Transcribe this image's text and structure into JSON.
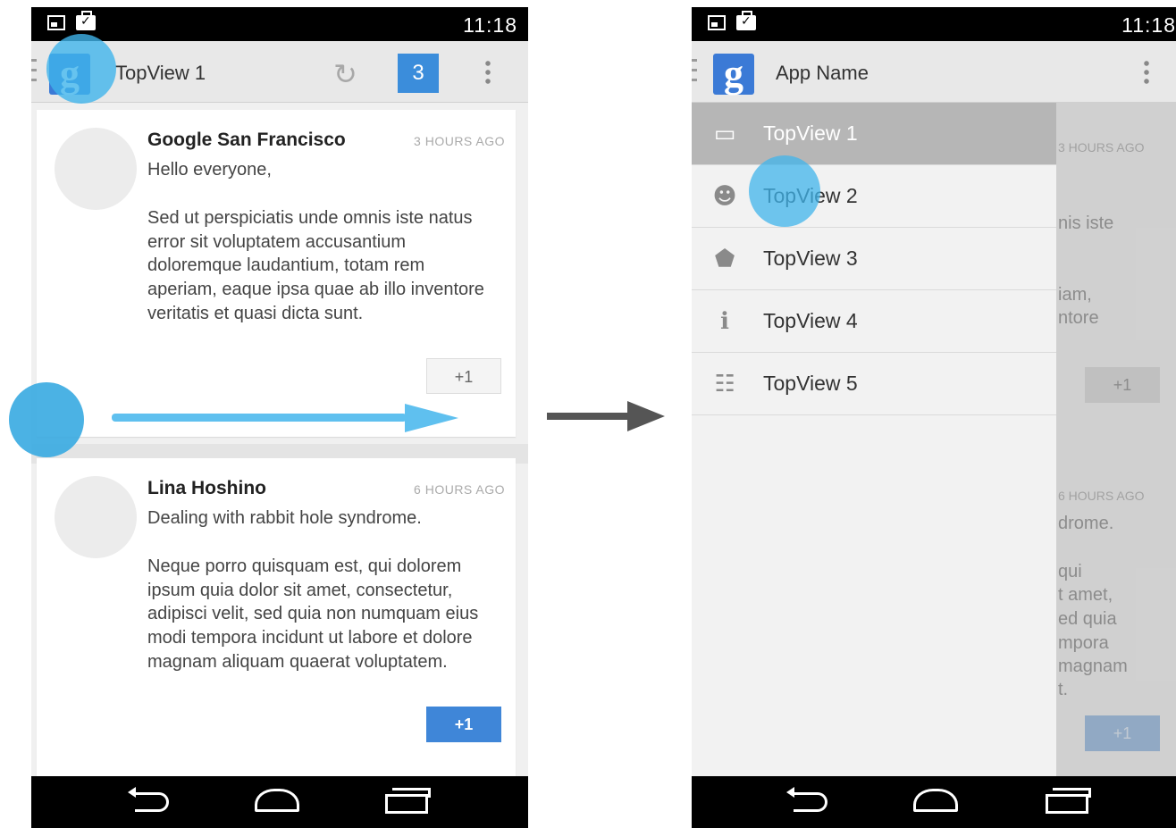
{
  "left_screen": {
    "status_time": "11:18",
    "action_bar": {
      "logo_letter": "g",
      "title": "TopView 1",
      "badge_count": "3"
    },
    "posts": [
      {
        "author": "Google San Francisco",
        "time": "3 HOURS AGO",
        "greeting": "Hello everyone,",
        "body": "Sed ut perspiciatis unde omnis iste natus error sit voluptatem accusantium doloremque laudantium, totam rem aperiam, eaque ipsa quae ab illo inventore veritatis et quasi dicta sunt.",
        "plus_label": "+1"
      },
      {
        "author": "Lina Hoshino",
        "time": "6 HOURS AGO",
        "greeting": "Dealing with rabbit hole syndrome.",
        "body": "Neque porro quisquam est, qui dolorem ipsum quia dolor sit amet, consectetur, adipisci velit, sed quia non numquam eius modi tempora incidunt ut labore et dolore magnam aliquam quaerat voluptatem.",
        "plus_label": "+1"
      }
    ]
  },
  "right_screen": {
    "status_time": "11:18",
    "action_bar": {
      "logo_letter": "g",
      "title": "App Name"
    },
    "drawer_items": [
      {
        "label": "TopView 1",
        "icon": "inbox-icon",
        "active": true
      },
      {
        "label": "TopView 2",
        "icon": "people-icon",
        "active": false
      },
      {
        "label": "TopView 3",
        "icon": "tag-icon",
        "active": false
      },
      {
        "label": "TopView 4",
        "icon": "info-icon",
        "active": false
      },
      {
        "label": "TopView 5",
        "icon": "chat-icon",
        "active": false
      }
    ],
    "background_fragments": {
      "time1": "3 HOURS AGO",
      "frag1": "nis iste",
      "frag2": "iam,",
      "frag3": "ntore",
      "plus1": "+1",
      "time2": "6 HOURS AGO",
      "frag4": "drome.",
      "frag5": "qui",
      "frag6": "t amet,",
      "frag7": "ed quia",
      "frag8": "mpora",
      "frag9": "magnam",
      "frag10": "t.",
      "plus2": "+1"
    }
  },
  "colors": {
    "accent": "#3b8ddb",
    "touch": "#40b4eb",
    "status_bar": "#000000"
  }
}
